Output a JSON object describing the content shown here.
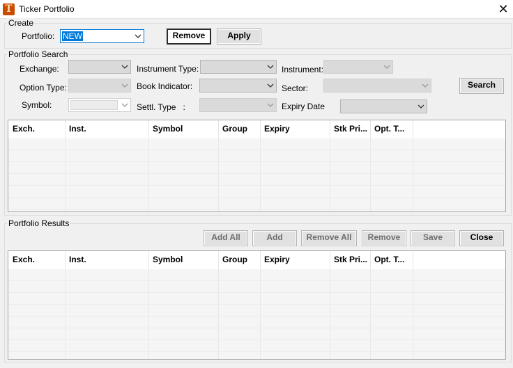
{
  "window": {
    "title": "Ticker Portfolio",
    "close_glyph": "✕",
    "icon_letter": "T"
  },
  "create": {
    "group_label": "Create",
    "portfolio_label": "Portfolio:",
    "portfolio_value": "NEW",
    "remove_label": "Remove",
    "apply_label": "Apply"
  },
  "search": {
    "group_label": "Portfolio Search",
    "exchange_label": "Exchange:",
    "instrument_type_label": "Instrument Type:",
    "instrument_label": "Instrument:",
    "option_type_label": "Option Type:",
    "book_indicator_label": "Book Indicator:",
    "sector_label": "Sector:",
    "symbol_label": "Symbol:",
    "settl_type_label": "Settl. Type   :",
    "expiry_date_label": "Expiry Date",
    "search_label": "Search"
  },
  "columns": [
    "Exch.",
    "Inst.",
    "Symbol",
    "Group",
    "Expiry",
    "Stk Pri...",
    "Opt. T..."
  ],
  "results": {
    "group_label": "Portfolio Results",
    "add_all_label": "Add All",
    "add_label": "Add",
    "remove_all_label": "Remove All",
    "remove_label": "Remove",
    "save_label": "Save",
    "close_label": "Close"
  },
  "colors": {
    "accent": "#0078d7",
    "app_icon": "#c84b00"
  }
}
